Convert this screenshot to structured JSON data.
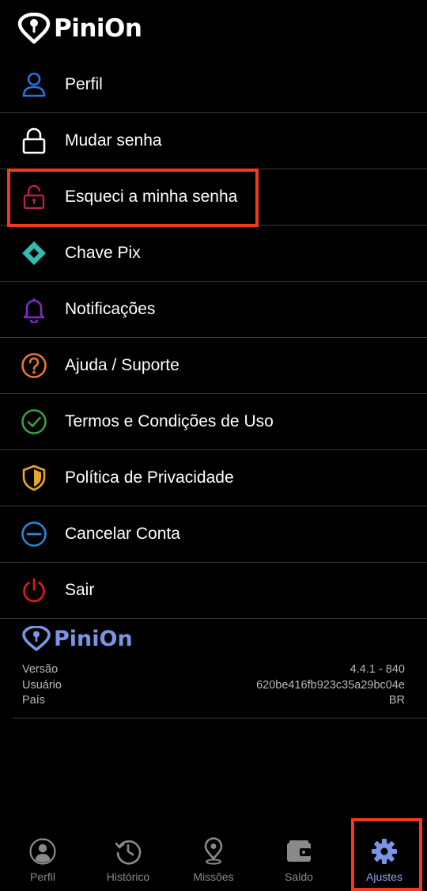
{
  "app": {
    "brand": "PiniOn",
    "accent": "#7a95e4",
    "highlight_color": "#f03b20"
  },
  "menu": {
    "items": [
      {
        "label": "Perfil",
        "icon": "person-icon",
        "color": "#2f6fe0"
      },
      {
        "label": "Mudar senha",
        "icon": "lock-icon",
        "color": "#ffffff"
      },
      {
        "label": "Esqueci a minha senha",
        "icon": "unlock-icon",
        "color": "#b2234f"
      },
      {
        "label": "Chave Pix",
        "icon": "pix-icon",
        "color": "#32bcad"
      },
      {
        "label": "Notificações",
        "icon": "bell-icon",
        "color": "#7b2fc4"
      },
      {
        "label": "Ajuda / Suporte",
        "icon": "help-icon",
        "color": "#e8792a"
      },
      {
        "label": "Termos e Condições de Uso",
        "icon": "check-circle-icon",
        "color": "#3e9e3e"
      },
      {
        "label": "Política de Privacidade",
        "icon": "shield-icon",
        "color": "#e8a72a"
      },
      {
        "label": "Cancelar Conta",
        "icon": "minus-circle-icon",
        "color": "#2b87d4"
      },
      {
        "label": "Sair",
        "icon": "power-icon",
        "color": "#d11b1b"
      }
    ]
  },
  "about": {
    "brand": "PiniOn",
    "version_label": "Versão",
    "version_value": "4.4.1 - 840",
    "user_label": "Usuário",
    "user_value": "620be416fb923c35a29bc04e",
    "country_label": "País",
    "country_value": "BR"
  },
  "bottom_nav": {
    "active": "Ajustes",
    "items": [
      {
        "label": "Perfil",
        "icon": "profile-icon"
      },
      {
        "label": "Histórico",
        "icon": "history-icon"
      },
      {
        "label": "Missões",
        "icon": "map-pin-icon"
      },
      {
        "label": "Saldo",
        "icon": "wallet-icon"
      },
      {
        "label": "Ajustes",
        "icon": "gear-icon"
      }
    ]
  }
}
